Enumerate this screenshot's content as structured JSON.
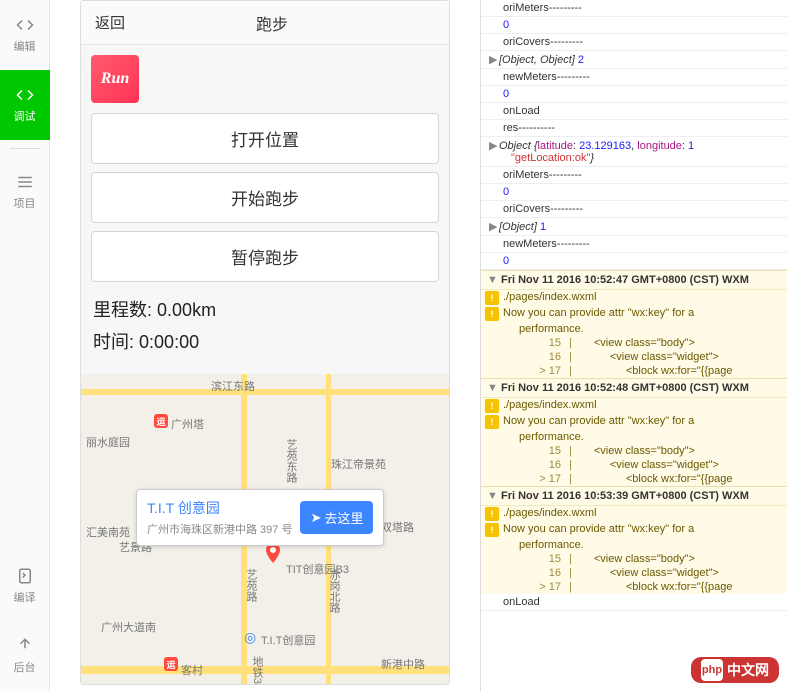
{
  "sidebar": {
    "items": [
      {
        "label": "编辑"
      },
      {
        "label": "调试"
      },
      {
        "label": "项目"
      },
      {
        "label": "编译"
      },
      {
        "label": "后台"
      }
    ]
  },
  "nav": {
    "back": "返回",
    "title": "跑步"
  },
  "logo_text": "Run",
  "buttons": {
    "open_loc": "打开位置",
    "start_run": "开始跑步",
    "pause_run": "暂停跑步"
  },
  "stats": {
    "mileage_label": "里程数:",
    "mileage_value": "0.00km",
    "time_label": "时间:",
    "time_value": "0:00:00"
  },
  "map": {
    "roads": {
      "binjiang_east": "滨江东路",
      "xin_gang_mid": "新港中路",
      "yi_yuan_east": "艺苑东路",
      "yi_yuan": "艺苑路",
      "chigang_north": "赤岗北路",
      "metro3": "地铁3"
    },
    "pois": {
      "liShui": "丽水庭园",
      "guangzhou_tower": "广州塔",
      "zhujiang": "珠江帝景苑",
      "shuangta": "双塔路",
      "yijing": "艺景路",
      "guangzhou_ave": "广州大道南",
      "huimei": "汇美南苑",
      "tit_b3": "TIT创意园B3",
      "tit_main": "T.I.T创意园",
      "kecun": "客村"
    },
    "metro_label": "运",
    "callout": {
      "title": "T.I.T 创意园",
      "sub": "广州市海珠区新港中路 397 号",
      "go": "去这里"
    }
  },
  "console": {
    "labels": {
      "oriMeters": "oriMeters---------",
      "oriCovers": "oriCovers---------",
      "newMeters": "newMeters---------",
      "onLoad": "onLoad",
      "res": "res----------"
    },
    "zero": "0",
    "objobj": "[Object, Object]",
    "objobj_n": "2",
    "obj": "[Object]",
    "obj_n": "1",
    "geo": {
      "prefix": "Object {",
      "lat_k": "latitude",
      "lat_v": "23.129163",
      "lon_k": "longitude",
      "lon_v": "1",
      "msg": "\"getLocation:ok\"",
      "suffix": "}"
    },
    "warns": [
      {
        "ts": "Fri Nov 11 2016 10:52:47 GMT+0800 (CST) WXM",
        "file": "./pages/index.wxml"
      },
      {
        "ts": "Fri Nov 11 2016 10:52:48 GMT+0800 (CST) WXM",
        "file": "./pages/index.wxml"
      },
      {
        "ts": "Fri Nov 11 2016 10:53:39 GMT+0800 (CST) WXM",
        "file": "./pages/index.wxml"
      }
    ],
    "warn_msg": "Now you can provide attr \"wx:key\" for a",
    "warn_perf": "performance.",
    "code": {
      "l15": "<view class=\"body\">",
      "l16": "<view class=\"widget\">",
      "l17": "<block wx:for=\"{{page"
    }
  },
  "watermark": {
    "brand": "php",
    "text": "中文网"
  }
}
